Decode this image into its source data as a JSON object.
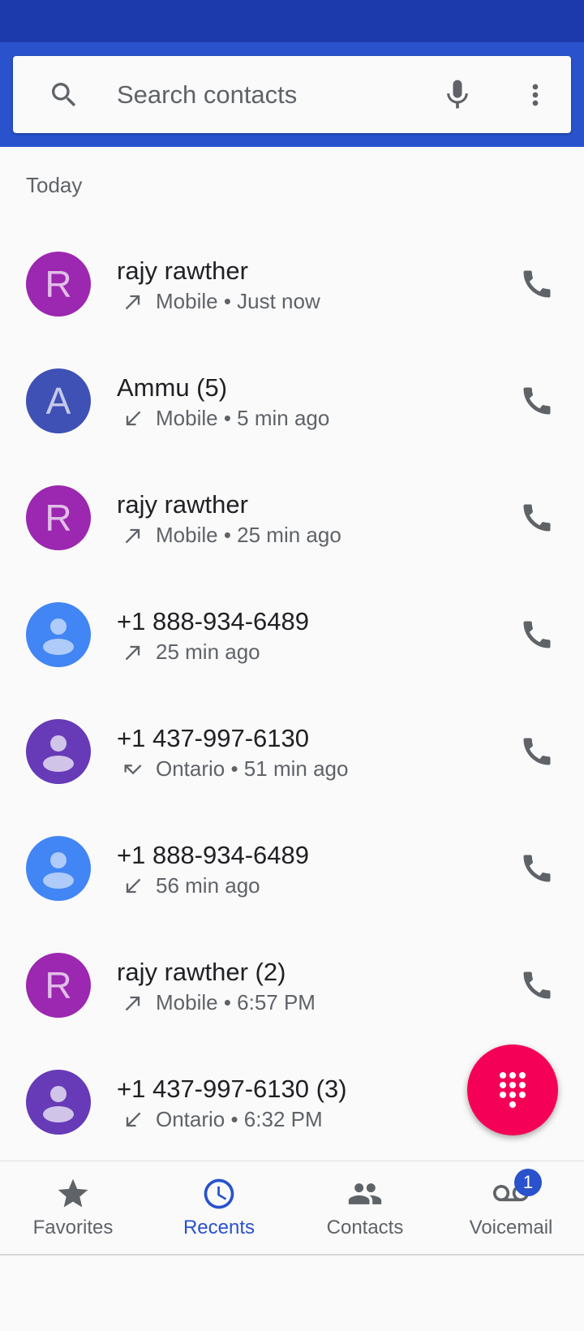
{
  "search": {
    "placeholder": "Search contacts"
  },
  "section": {
    "today": "Today"
  },
  "calls": [
    {
      "avatar": "R",
      "avatar_bg": "#9c27b0",
      "avatar_fg": "#e1bee7",
      "name": "rajy rawther",
      "direction": "outgoing",
      "detail": "Mobile • Just now"
    },
    {
      "avatar": "A",
      "avatar_bg": "#3f51b5",
      "avatar_fg": "#c5cae9",
      "name": "Ammu  (5)",
      "direction": "incoming",
      "detail": "Mobile • 5 min ago"
    },
    {
      "avatar": "R",
      "avatar_bg": "#9c27b0",
      "avatar_fg": "#e1bee7",
      "name": "rajy rawther",
      "direction": "outgoing",
      "detail": "Mobile • 25 min ago"
    },
    {
      "avatar": "person",
      "avatar_bg": "#4285f4",
      "avatar_fg": "#aecbfa",
      "name": "+1 888-934-6489",
      "direction": "outgoing",
      "detail": "25 min ago"
    },
    {
      "avatar": "person",
      "avatar_bg": "#673ab7",
      "avatar_fg": "#d1c4e9",
      "name": "+1 437-997-6130",
      "direction": "missed",
      "detail": "Ontario • 51 min ago"
    },
    {
      "avatar": "person",
      "avatar_bg": "#4285f4",
      "avatar_fg": "#aecbfa",
      "name": "+1 888-934-6489",
      "direction": "incoming",
      "detail": "56 min ago"
    },
    {
      "avatar": "R",
      "avatar_bg": "#9c27b0",
      "avatar_fg": "#e1bee7",
      "name": "rajy rawther  (2)",
      "direction": "outgoing",
      "detail": "Mobile • 6:57 PM"
    },
    {
      "avatar": "person",
      "avatar_bg": "#673ab7",
      "avatar_fg": "#d1c4e9",
      "name": "+1 437-997-6130  (3)",
      "direction": "incoming",
      "detail": "Ontario • 6:32 PM"
    }
  ],
  "nav": {
    "favorites": "Favorites",
    "recents": "Recents",
    "contacts": "Contacts",
    "voicemail": "Voicemail",
    "voicemail_badge": "1"
  },
  "colors": {
    "accent": "#2952cc",
    "status_bar": "#1d3aac",
    "fab": "#f50057"
  }
}
